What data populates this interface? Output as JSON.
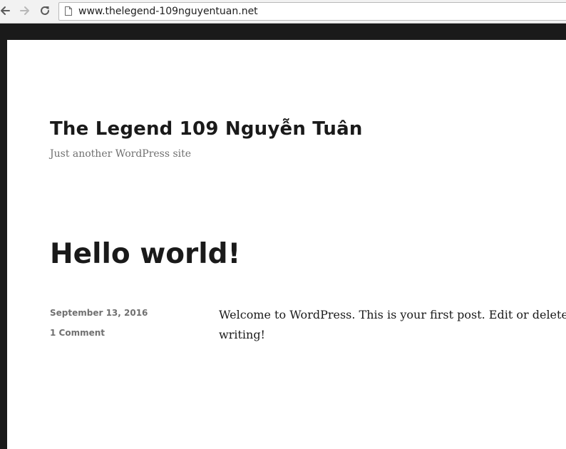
{
  "browser": {
    "url": "www.thelegend-109nguyentuan.net"
  },
  "site": {
    "title": "The Legend 109 Nguyễn Tuân",
    "description": "Just another WordPress site"
  },
  "post": {
    "title": "Hello world!",
    "date": "September 13, 2016",
    "comments": "1 Comment",
    "body_line1": "Welcome to WordPress. This is your first post. Edit or delete",
    "body_line2": "writing!"
  }
}
